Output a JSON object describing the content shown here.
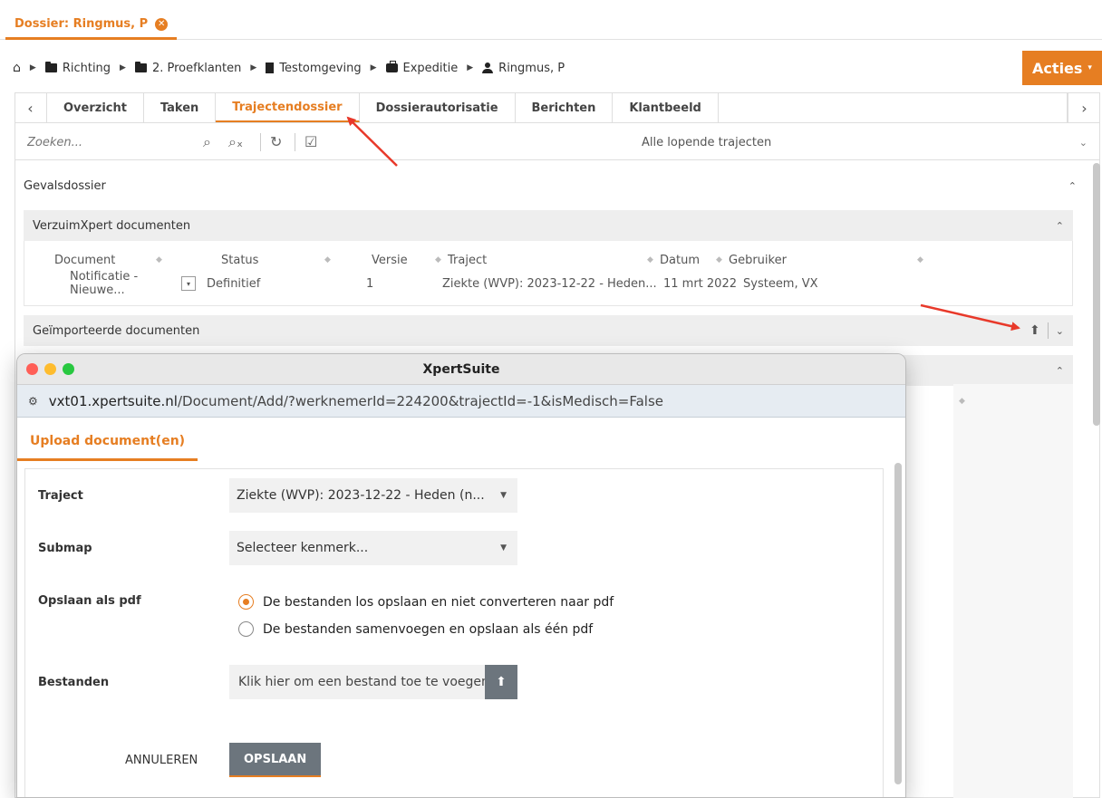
{
  "dossier_tab": {
    "label": "Dossier: Ringmus, P",
    "close_icon": "close-circle-icon"
  },
  "breadcrumb": {
    "items": [
      {
        "icon": "home-icon",
        "label": ""
      },
      {
        "icon": "folder-icon",
        "label": "Richting"
      },
      {
        "icon": "folder-icon",
        "label": "2. Proefklanten"
      },
      {
        "icon": "building-icon",
        "label": "Testomgeving"
      },
      {
        "icon": "briefcase-icon",
        "label": "Expeditie"
      },
      {
        "icon": "user-icon",
        "label": "Ringmus, P"
      }
    ]
  },
  "actions_button": {
    "label": "Acties"
  },
  "tabs": [
    {
      "label": "Overzicht"
    },
    {
      "label": "Taken"
    },
    {
      "label": "Trajectendossier",
      "active": true
    },
    {
      "label": "Dossierautorisatie"
    },
    {
      "label": "Berichten"
    },
    {
      "label": "Klantbeeld"
    }
  ],
  "toolbar": {
    "search_placeholder": "Zoeken...",
    "filter_value": "Alle lopende trajecten"
  },
  "sections": {
    "gevalsdossier": "Gevalsdossier",
    "verzuimxpert": "VerzuimXpert documenten",
    "imported": "Geïmporteerde documenten"
  },
  "doc_table": {
    "columns": [
      "Document",
      "Status",
      "Versie",
      "Traject",
      "Datum",
      "Gebruiker"
    ],
    "rows": [
      {
        "document": "Notificatie - Nieuwe...",
        "status": "Definitief",
        "versie": "1",
        "traject": "Ziekte (WVP): 2023-12-22 - Heden...",
        "datum": "11 mrt 2022",
        "gebruiker": "Systeem, VX"
      }
    ]
  },
  "popup": {
    "title": "XpertSuite",
    "url_domain": "vxt01.xpertsuite.nl",
    "url_path": "/Document/Add/?werknemerId=224200&trajectId=-1&isMedisch=False",
    "tab_label": "Upload document(en)",
    "form": {
      "traject_label": "Traject",
      "traject_value": "Ziekte (WVP): 2023-12-22 - Heden (n...",
      "submap_label": "Submap",
      "submap_value": "Selecteer kenmerk...",
      "pdf_label": "Opslaan als pdf",
      "pdf_option_1": "De bestanden los opslaan en niet converteren naar pdf",
      "pdf_option_2": "De bestanden samenvoegen en opslaan als één pdf",
      "files_label": "Bestanden",
      "files_placeholder": "Klik hier om een bestand toe te voegen",
      "cancel_label": "ANNULEREN",
      "save_label": "OPSLAAN"
    }
  },
  "colors": {
    "accent": "#e67e22",
    "arrow": "#e8392a",
    "button_gray": "#6c757d"
  }
}
